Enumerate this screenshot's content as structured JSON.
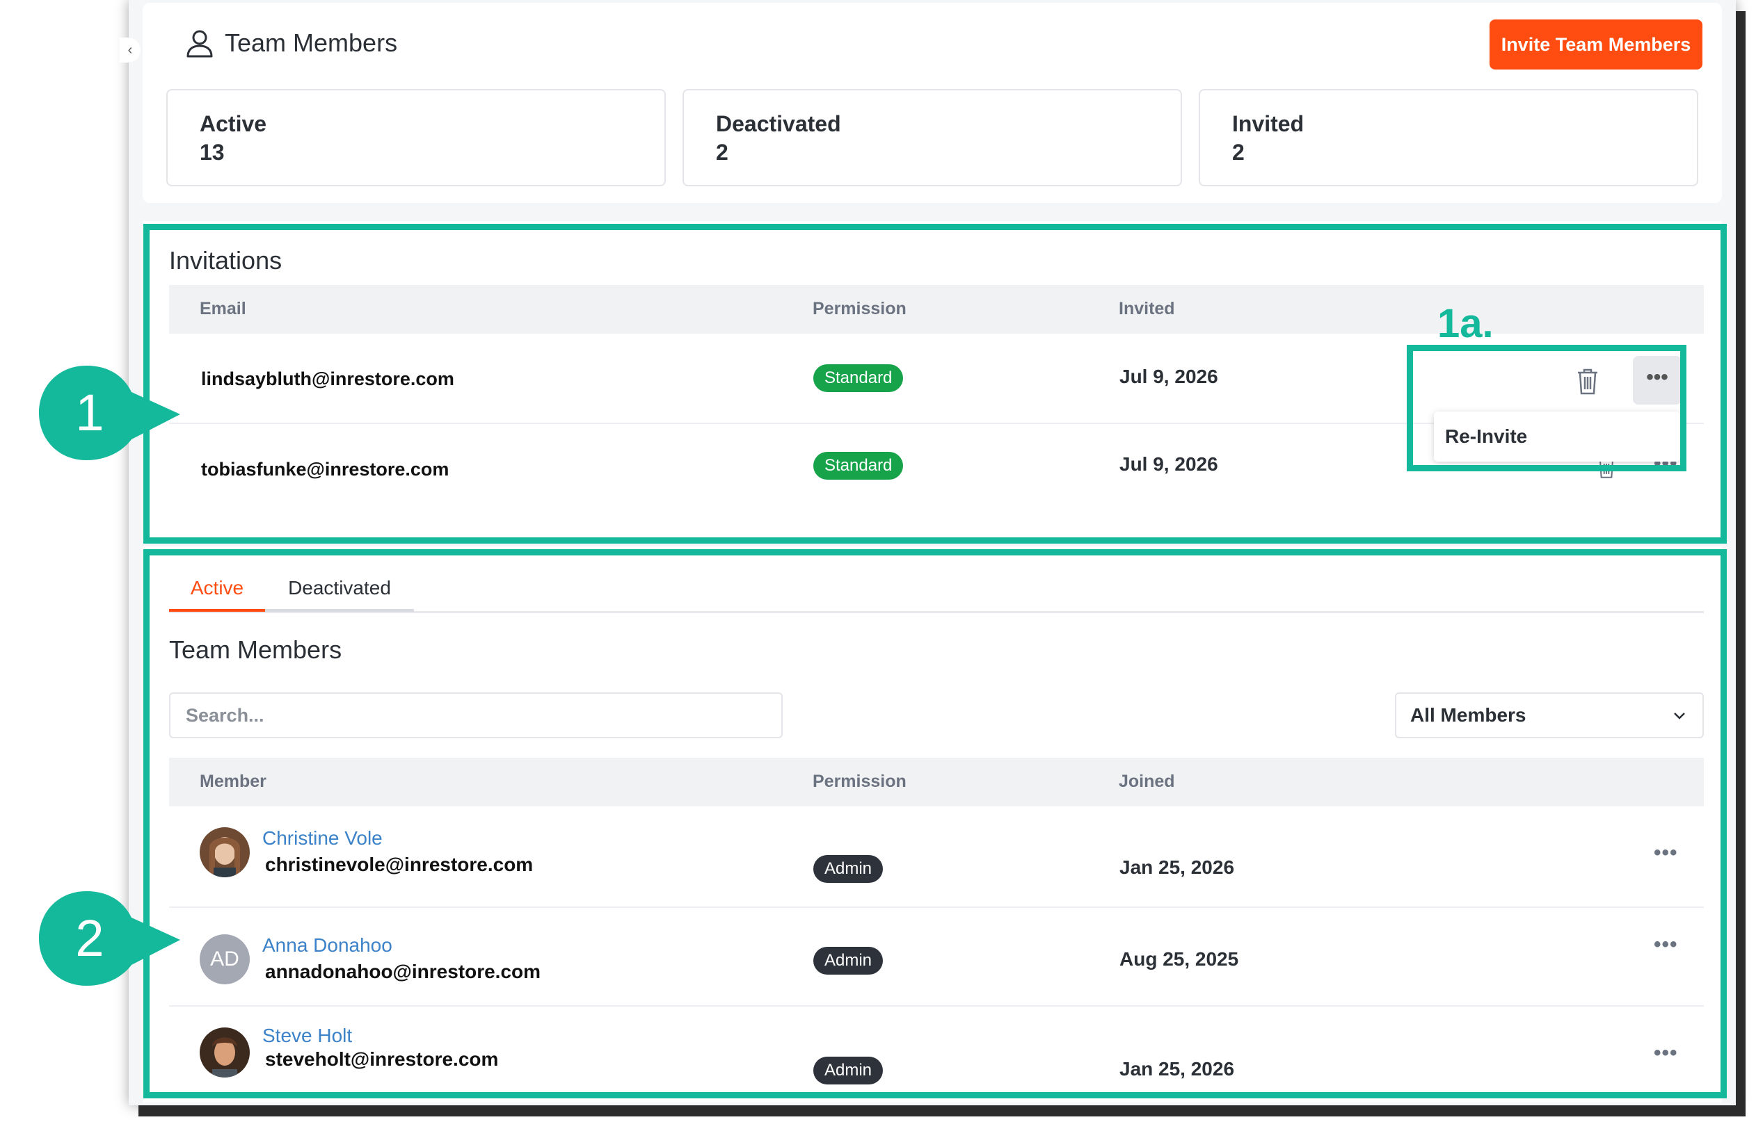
{
  "header": {
    "title": "Team Members",
    "invite_button": "Invite Team Members"
  },
  "stats": [
    {
      "label": "Active",
      "value": "13"
    },
    {
      "label": "Deactivated",
      "value": "2"
    },
    {
      "label": "Invited",
      "value": "2"
    }
  ],
  "invitations": {
    "title": "Invitations",
    "columns": {
      "email": "Email",
      "permission": "Permission",
      "invited": "Invited"
    },
    "rows": [
      {
        "email": "lindsaybluth@inrestore.com",
        "permission": "Standard",
        "invited": "Jul 9, 2026"
      },
      {
        "email": "tobiasfunke@inrestore.com",
        "permission": "Standard",
        "invited": "Jul 9, 2026"
      }
    ],
    "menu": {
      "reinvite": "Re-Invite",
      "more": "•••"
    }
  },
  "members": {
    "tabs": {
      "active": "Active",
      "deactivated": "Deactivated"
    },
    "title": "Team Members",
    "search_placeholder": "Search...",
    "filter": "All Members",
    "columns": {
      "member": "Member",
      "permission": "Permission",
      "joined": "Joined"
    },
    "rows": [
      {
        "name": "Christine Vole",
        "email": "christinevole@inrestore.com",
        "permission": "Admin",
        "joined": "Jan 25, 2026",
        "initials": ""
      },
      {
        "name": "Anna Donahoo",
        "email": "annadonahoo@inrestore.com",
        "permission": "Admin",
        "joined": "Aug 25, 2025",
        "initials": "AD"
      },
      {
        "name": "Steve Holt",
        "email": "steveholt@inrestore.com",
        "permission": "Admin",
        "joined": "Jan 25, 2026",
        "initials": ""
      }
    ],
    "more": "•••"
  },
  "annotations": {
    "callout_1": "1",
    "label_1a": "1a.",
    "callout_2": "2"
  },
  "colors": {
    "accent": "#ff4d12",
    "annotation": "#14b89a",
    "standard": "#17a34a",
    "admin": "#2d323b",
    "link": "#3b82c8"
  }
}
